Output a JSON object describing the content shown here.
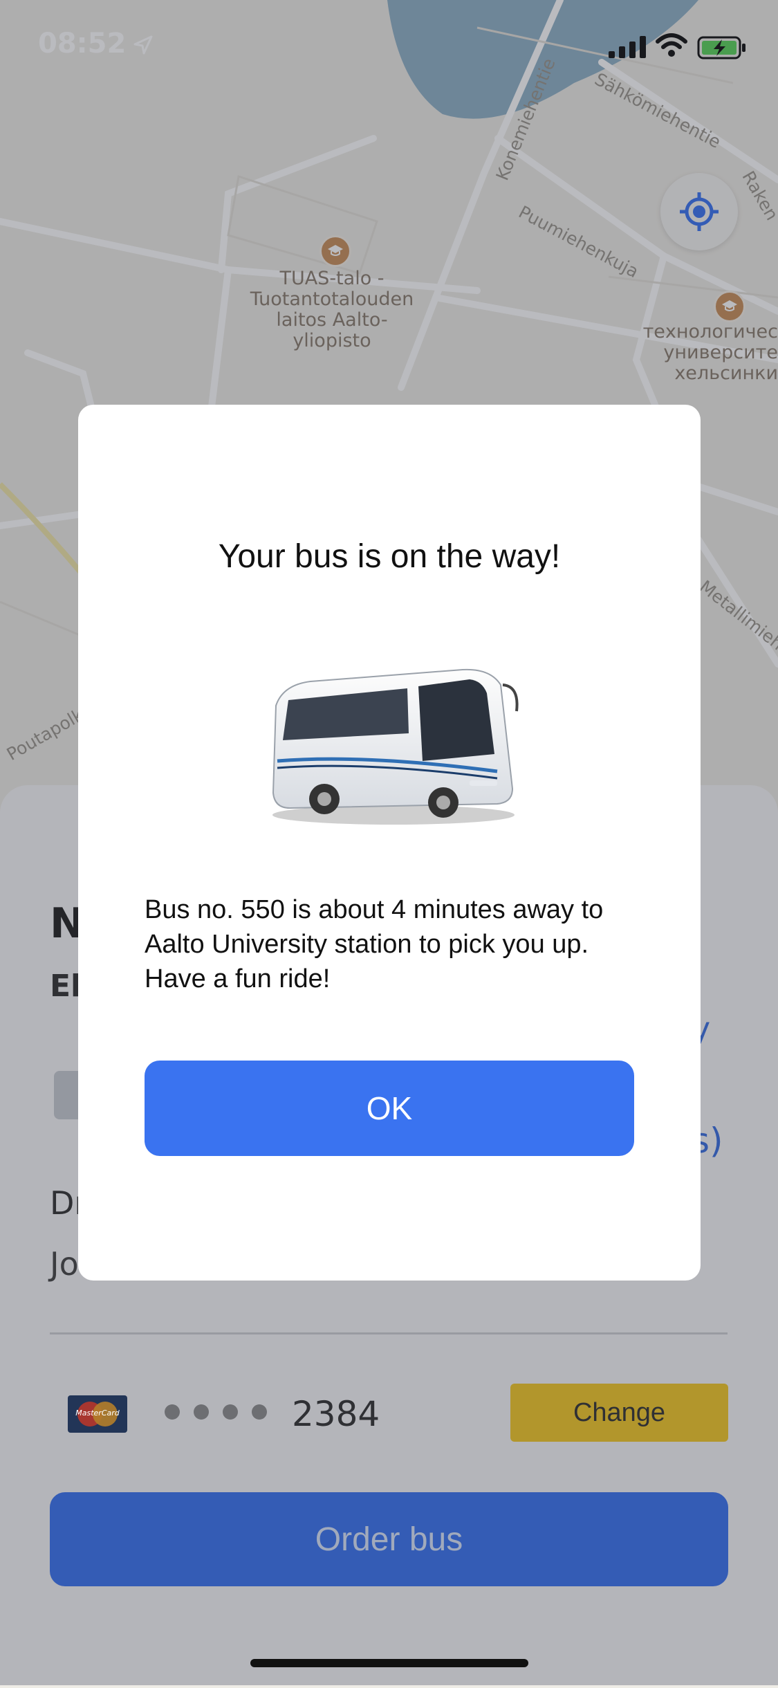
{
  "status_bar": {
    "time": "08:52"
  },
  "map": {
    "poi_tuas": "TUAS-talo - Tuotantotalouden laitos Aalto-yliopisto",
    "poi_tuas_lines": [
      "TUAS-talo -",
      "Tuotantotalouden",
      "laitos Aalto-",
      "yliopisto"
    ],
    "poi_tech_lines": [
      "технологичес",
      "университе",
      "хельсинки"
    ],
    "streets": {
      "konemiehentie": "Konemiehentie",
      "sahkomiehentie": "Sähkömiehentie",
      "puumiehenkuja": "Puumiehenkuja",
      "raken": "Raken",
      "metallimiehe": "Metallimiehe",
      "poutapolku": "Poutapolk"
    }
  },
  "sheet": {
    "title_partial": "N",
    "subtitle_partial": "El",
    "driver_label_partial": "Dr",
    "driver_value_partial": "Jo",
    "side_a": "y",
    "side_b": "s)",
    "card_brand": "MasterCard",
    "card_last4": "2384",
    "change_label": "Change",
    "order_label": "Order bus"
  },
  "modal": {
    "title": "Your bus is on the way!",
    "message": "Bus no. 550 is about 4 minutes away to Aalto University station to pick you up. Have a fun ride!",
    "ok_label": "OK"
  },
  "colors": {
    "accent_blue": "#3a73f0",
    "accent_yellow": "#f3c927",
    "map_water": "#8fb1c6"
  }
}
